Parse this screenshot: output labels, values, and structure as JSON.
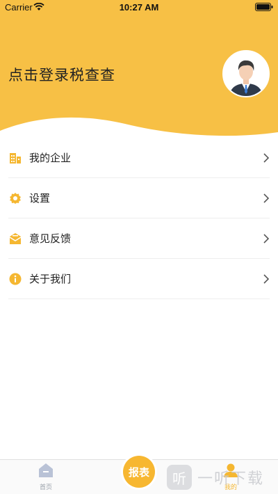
{
  "status_bar": {
    "carrier": "Carrier",
    "time": "10:27 AM"
  },
  "header": {
    "title": "点击登录税查查",
    "background_color": "#f7c045",
    "avatar_icon": "user-avatar-icon"
  },
  "menu": {
    "items": [
      {
        "label": "我的企业",
        "icon": "building-icon"
      },
      {
        "label": "设置",
        "icon": "gear-icon"
      },
      {
        "label": "意见反馈",
        "icon": "feedback-envelope-icon"
      },
      {
        "label": "关于我们",
        "icon": "info-icon"
      }
    ],
    "icon_color": "#f5b731"
  },
  "tabbar": {
    "home_label": "首页",
    "report_label": "报表",
    "mine_label": "我的",
    "active_color": "#f5b731",
    "inactive_color": "#9aa0aa"
  },
  "watermark": {
    "text": "一听下载",
    "logo_glyph": "听"
  }
}
